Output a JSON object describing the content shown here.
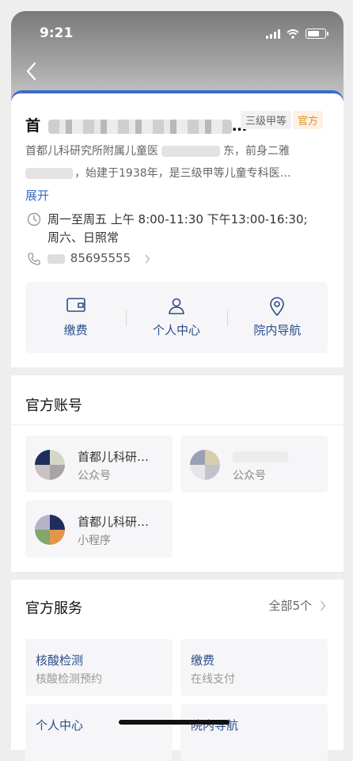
{
  "status_bar": {
    "time": "9:21"
  },
  "hospital": {
    "name_prefix": "首",
    "name_suffix": "…",
    "grade_tag": "三级甲等",
    "official_tag": "官方",
    "desc_line1_a": "首都儿科研究所附属儿童医",
    "desc_line1_b": "东，前身二雅",
    "desc_line2_a": "",
    "desc_line2_b": "，始建于1938年，",
    "desc_line2_c": "是三级甲等儿童专科医…",
    "expand_label": "展开",
    "hours_line1": "周一至周五 上午 8:00-11:30 下午13:00-16:30;",
    "hours_line2": "周六、日照常",
    "phone_visible": "85695555"
  },
  "quick_actions": [
    {
      "label": "缴费",
      "icon": "wallet-icon"
    },
    {
      "label": "个人中心",
      "icon": "person-icon"
    },
    {
      "label": "院内导航",
      "icon": "location-pin-icon"
    }
  ],
  "official_accounts": {
    "title": "官方账号",
    "items": [
      {
        "name": "首都儿科研…",
        "type": "公众号"
      },
      {
        "name": "",
        "type": "公众号"
      },
      {
        "name": "首都儿科研…",
        "type": "小程序"
      }
    ]
  },
  "official_services": {
    "title": "官方服务",
    "all_label": "全部5个",
    "items": [
      {
        "title": "核酸检测",
        "subtitle": "核酸检测预约"
      },
      {
        "title": "缴费",
        "subtitle": "在线支付"
      },
      {
        "title": "个人中心",
        "subtitle": ""
      },
      {
        "title": "院内导航",
        "subtitle": ""
      }
    ]
  },
  "colors": {
    "accent": "#2b4c8a",
    "link": "#3b6cc8",
    "official": "#e0902e"
  }
}
